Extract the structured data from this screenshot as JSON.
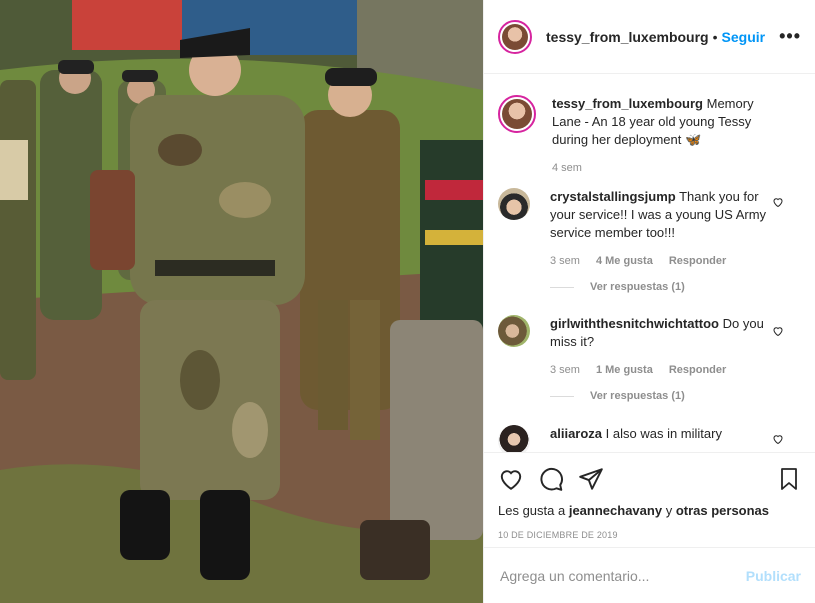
{
  "post": {
    "username": "tessy_from_luxembourg",
    "separator": "•",
    "follow_label": "Seguir",
    "more_label": "•••",
    "caption_username": "tessy_from_luxembourg",
    "caption_text": "Memory Lane - An 18 year old young Tessy during her deployment 🦋",
    "caption_time": "4 sem"
  },
  "comments": [
    {
      "username": "crystalstallingsjump",
      "text": "Thank you for your service!! I was a young US Army service member too!!!",
      "time": "3 sem",
      "likes": "4 Me gusta",
      "reply": "Responder",
      "view_replies": "Ver respuestas (1)"
    },
    {
      "username": "girlwiththesnitchwichtattoo",
      "text": "Do you miss it?",
      "time": "3 sem",
      "likes": "1 Me gusta",
      "reply": "Responder",
      "view_replies": "Ver respuestas (1)"
    },
    {
      "username": "aliiaroza",
      "text": "I also was in military"
    }
  ],
  "likes_line": {
    "prefix": "Les gusta a",
    "user": "jeannechavany",
    "middle": "y",
    "others": "otras personas"
  },
  "date": "10 DE DICIEMBRE DE 2019",
  "add_comment": {
    "placeholder": "Agrega un comentario...",
    "publish_label": "Publicar"
  },
  "colors": {
    "link": "#0095f6",
    "publish_disabled": "#b2dffc",
    "muted": "#8e8e8e",
    "story_ring": "#d6249f"
  }
}
